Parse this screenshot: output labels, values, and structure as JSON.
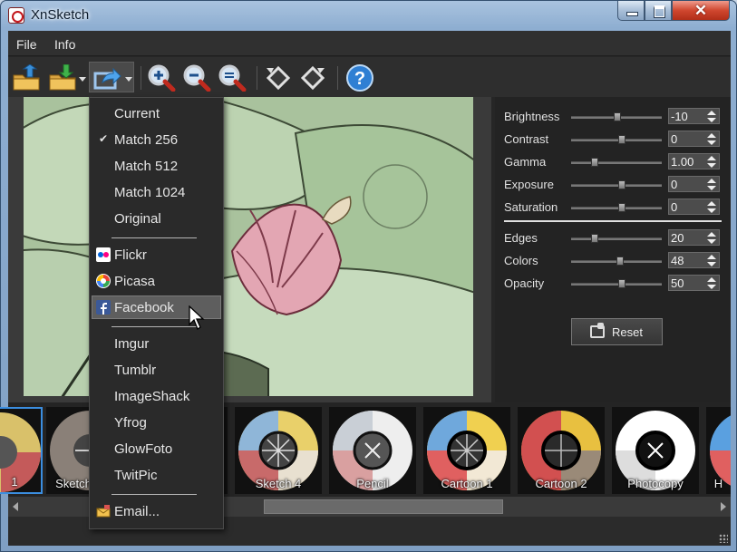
{
  "window": {
    "title": "XnSketch",
    "close_glyph": "✕"
  },
  "menubar": {
    "items": [
      "File",
      "Info"
    ]
  },
  "toolbar": {
    "icons": [
      "open-folder-icon",
      "save-folder-icon",
      "share-icon",
      "zoom-in-icon",
      "zoom-out-icon",
      "zoom-fit-icon",
      "rotate-left-icon",
      "rotate-right-icon",
      "help-icon"
    ],
    "help_glyph": "?"
  },
  "share_menu": {
    "size_items": [
      {
        "label": "Current",
        "checked": false
      },
      {
        "label": "Match 256",
        "checked": true
      },
      {
        "label": "Match 512",
        "checked": false
      },
      {
        "label": "Match 1024",
        "checked": false
      },
      {
        "label": "Original",
        "checked": false
      }
    ],
    "check_glyph": "✔",
    "services": [
      {
        "label": "Flickr",
        "icon": "flickr-icon"
      },
      {
        "label": "Picasa",
        "icon": "picasa-icon"
      },
      {
        "label": "Facebook",
        "icon": "facebook-icon",
        "hover": true
      }
    ],
    "other_services": [
      "Imgur",
      "Tumblr",
      "ImageShack",
      "Yfrog",
      "GlowFoto",
      "TwitPic"
    ],
    "email": {
      "label": "Email...",
      "icon": "email-icon"
    }
  },
  "adjustments": {
    "basic": [
      {
        "label": "Brightness",
        "value": "-10",
        "position": 0.45
      },
      {
        "label": "Contrast",
        "value": "0",
        "position": 0.5
      },
      {
        "label": "Gamma",
        "value": "1.00",
        "position": 0.2
      },
      {
        "label": "Exposure",
        "value": "0",
        "position": 0.5
      },
      {
        "label": "Saturation",
        "value": "0",
        "position": 0.5
      }
    ],
    "sketch": [
      {
        "label": "Edges",
        "value": "20",
        "position": 0.2
      },
      {
        "label": "Colors",
        "value": "48",
        "position": 0.48
      },
      {
        "label": "Opacity",
        "value": "50",
        "position": 0.5
      }
    ],
    "reset_label": "Reset"
  },
  "filmstrip": {
    "thumbnails": [
      {
        "label": "1",
        "selected": true
      },
      {
        "label": "Sketch",
        "selected": false
      },
      {
        "label": "",
        "selected": false
      },
      {
        "label": "Sketch 4",
        "selected": false
      },
      {
        "label": "Pencil",
        "selected": false
      },
      {
        "label": "Cartoon 1",
        "selected": false
      },
      {
        "label": "Cartoon 2",
        "selected": false
      },
      {
        "label": "Photocopy",
        "selected": false
      },
      {
        "label": "H",
        "selected": false
      }
    ]
  },
  "colors": {
    "accent": "#3b8ee0",
    "panel_bg": "#232323",
    "menu_hover": "#5e5e5e"
  }
}
